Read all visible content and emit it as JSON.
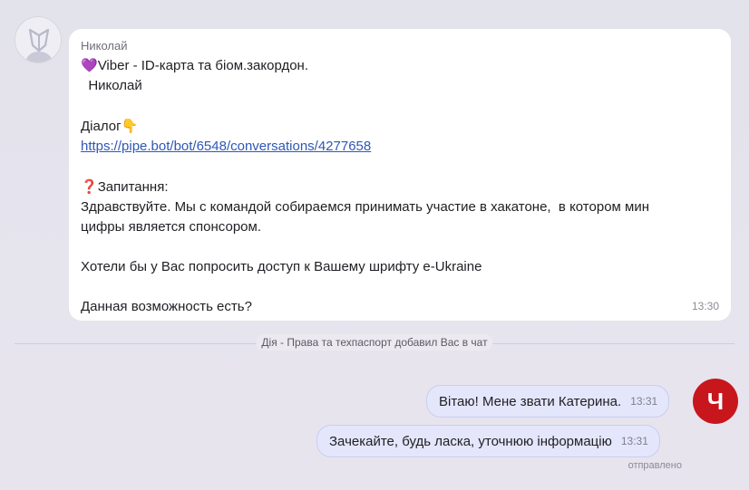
{
  "incoming": {
    "sender": "Николай",
    "lines": [
      {
        "emoji": "💜",
        "text": "Viber - ID-карта та біом.закордон."
      },
      {
        "emoji": "",
        "text": "  Николай"
      },
      {
        "emoji": "",
        "text": ""
      },
      {
        "emoji": "",
        "text": "Діалог",
        "suffix_emoji": "👇"
      },
      {
        "link": "https://pipe.bot/bot/6548/conversations/4277658"
      },
      {
        "emoji": "",
        "text": ""
      },
      {
        "emoji": "❓",
        "text": "Запитання:"
      },
      {
        "emoji": "",
        "text": "Здравствуйте. Мы с командой собираемся принимать участие в хакатоне,  в котором мин"
      },
      {
        "emoji": "",
        "text": "цифры является спонсором."
      },
      {
        "emoji": "",
        "text": ""
      },
      {
        "emoji": "",
        "text": "Хотели бы у Вас попросить доступ к Вашему шрифту e-Ukraine"
      },
      {
        "emoji": "",
        "text": ""
      },
      {
        "emoji": "",
        "text": "Данная возможность есть?"
      }
    ],
    "time": "13:30"
  },
  "divider": "Дія - Права та техпаспорт добавил Вас в чат",
  "outgoing": [
    {
      "text": "Вітаю! Мене звати Катерина.",
      "time": "13:31"
    },
    {
      "text": "Зачекайте, будь ласка, уточнюю інформацію",
      "time": "13:31"
    }
  ],
  "agent_initial": "Ч",
  "status": "отправлено",
  "colors": {
    "accent": "#c8161d",
    "outgoing_bubble": "#e4e6fb",
    "link": "#2e57b8"
  }
}
